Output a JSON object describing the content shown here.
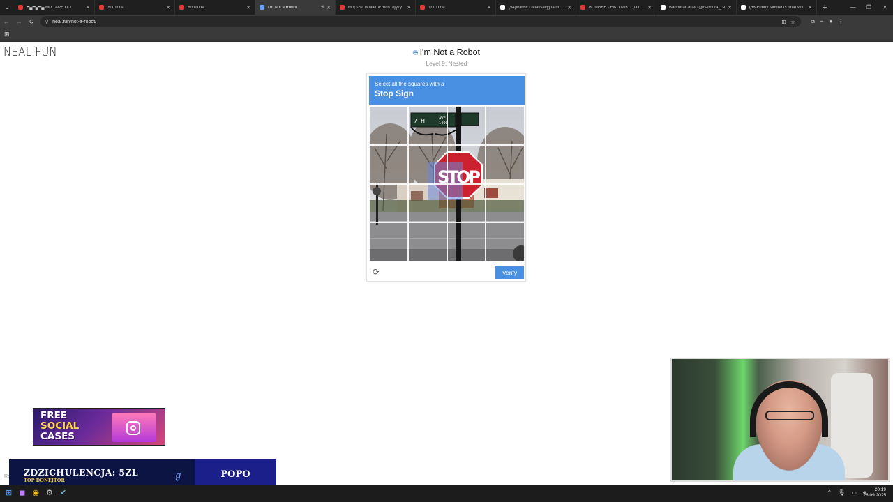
{
  "browser": {
    "tabs": [
      {
        "title": "▀▄▀▄▀▄ MIXTAPE DO",
        "fav_color": "#e53935",
        "active": false,
        "speaker": false
      },
      {
        "title": "YouTube",
        "fav_color": "#e53935",
        "active": false,
        "speaker": false
      },
      {
        "title": "YouTube",
        "fav_color": "#e53935",
        "active": false,
        "speaker": false
      },
      {
        "title": "I'm Not a Robot",
        "fav_color": "#6aa0ff",
        "active": true,
        "speaker": true
      },
      {
        "title": "Mój szef w Niemczech. #języ",
        "fav_color": "#e53935",
        "active": false,
        "speaker": false
      },
      {
        "title": "YouTube",
        "fav_color": "#e53935",
        "active": false,
        "speaker": false
      },
      {
        "title": "(54)Miłość i relaksacyjna muzy",
        "fav_color": "#ffffff",
        "active": false,
        "speaker": false
      },
      {
        "title": "BUNGEE - FIKU MIKU (Officia",
        "fav_color": "#e53935",
        "active": false,
        "speaker": false
      },
      {
        "title": "BandurаCartel (@bandura_ca",
        "fav_color": "#ffffff",
        "active": false,
        "speaker": false
      },
      {
        "title": "(68)Funny Moments That Wil",
        "fav_color": "#ffffff",
        "active": false,
        "speaker": false
      }
    ],
    "url": "neal.fun/not-a-robot/"
  },
  "page": {
    "logo": "NEAL.FUN",
    "title": "I'm Not a Robot",
    "subtitle": "Level 9: Nested"
  },
  "captcha": {
    "instruction": "Select all the squares with a",
    "target": "Stop Sign",
    "street_sign_top": "7TH",
    "street_sign_right": "AVE",
    "street_sign_num": "1400",
    "stop_text": "STOP",
    "verify_label": "Verify",
    "accent": "#4a90e2"
  },
  "overlays": {
    "promo_line1": "FREE",
    "promo_line2": "SOCIAL",
    "promo_line3": "CASES",
    "donation_main": "ZDZICHULENCJA: 5ZL",
    "donation_sub": "TOP DONEJTOR",
    "donation_name": "POPO",
    "corner_letter": "Re"
  },
  "taskbar": {
    "time": "20:19",
    "date": "28.09.2025"
  }
}
